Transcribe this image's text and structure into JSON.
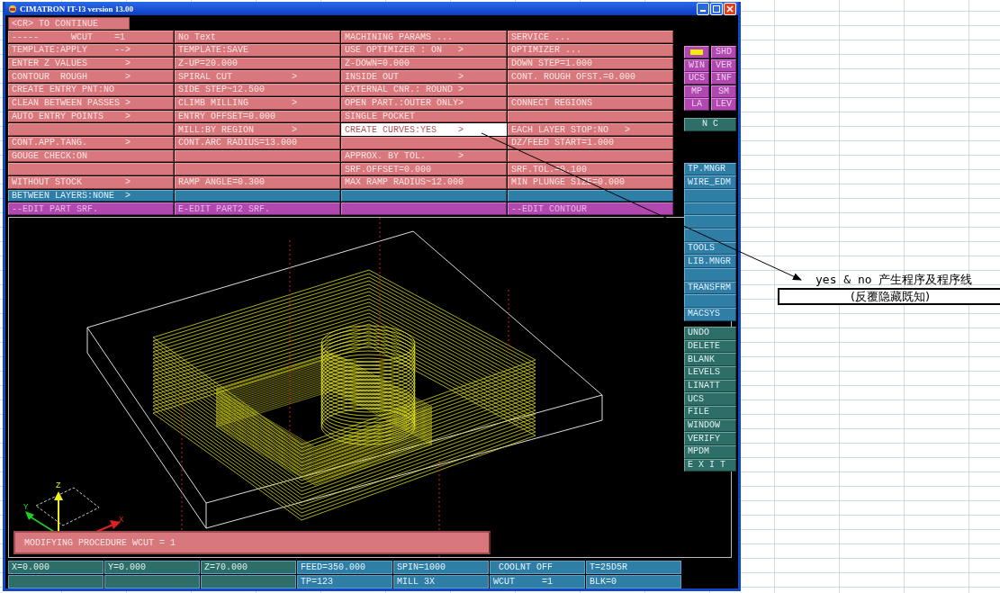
{
  "window": {
    "title": "CIMATRON IT-13 version 13.00"
  },
  "prompt": "<CR> TO CONTINUE",
  "menu": {
    "rows": [
      {
        "kind": "params",
        "cells": [
          {
            "label": "-----      WCUT    =1",
            "selected": false
          },
          {
            "label": "No Text",
            "selected": false
          },
          {
            "label": "MACHINING PARAMS ...",
            "selected": false
          },
          {
            "label": "SERVICE ...",
            "selected": false
          }
        ]
      },
      {
        "kind": "params",
        "cells": [
          {
            "label": "TEMPLATE:APPLY     -->",
            "selected": false
          },
          {
            "label": "TEMPLATE:SAVE",
            "selected": false
          },
          {
            "label": "USE OPTIMIZER : ON   >",
            "selected": false
          },
          {
            "label": "OPTIMIZER ...",
            "selected": false
          }
        ]
      },
      {
        "kind": "params",
        "cells": [
          {
            "label": "ENTER Z VALUES       >",
            "selected": false
          },
          {
            "label": "Z-UP=20.000",
            "selected": false
          },
          {
            "label": "Z-DOWN=0.000",
            "selected": false
          },
          {
            "label": "DOWN STEP=1.000",
            "selected": false
          }
        ]
      },
      {
        "kind": "params",
        "cells": [
          {
            "label": "CONTOUR  ROUGH       >",
            "selected": false
          },
          {
            "label": "SPIRAL CUT           >",
            "selected": false
          },
          {
            "label": "INSIDE OUT           >",
            "selected": false
          },
          {
            "label": "CONT. ROUGH OFST.=0.000",
            "selected": false
          }
        ]
      },
      {
        "kind": "params",
        "cells": [
          {
            "label": "CREATE ENTRY PNT:NO",
            "selected": false
          },
          {
            "label": "SIDE STEP~12.500",
            "selected": false
          },
          {
            "label": "EXTERNAL CNR.: ROUND >",
            "selected": false
          },
          {
            "selected": false
          }
        ]
      },
      {
        "kind": "params",
        "cells": [
          {
            "label": "CLEAN BETWEEN PASSES >",
            "selected": false
          },
          {
            "label": "CLIMB MILLING        >",
            "selected": false
          },
          {
            "label": "OPEN PART.:OUTER ONLY>",
            "selected": false
          },
          {
            "label": "CONNECT REGIONS",
            "selected": false
          }
        ]
      },
      {
        "kind": "params",
        "cells": [
          {
            "label": "AUTO ENTRY POINTS    >",
            "selected": false
          },
          {
            "label": "ENTRY OFFSET=0.000",
            "selected": false
          },
          {
            "label": "SINGLE POCKET",
            "selected": false
          },
          {
            "selected": false
          }
        ]
      },
      {
        "kind": "params",
        "cells": [
          {
            "selected": false
          },
          {
            "label": "MILL:BY REGION       >",
            "selected": false
          },
          {
            "label": "CREATE CURVES:YES    >",
            "selected": true
          },
          {
            "label": "EACH LAYER STOP:NO   >",
            "selected": false
          }
        ]
      },
      {
        "kind": "params",
        "cells": [
          {
            "label": "CONT.APP.TANG.       >",
            "selected": false
          },
          {
            "label": "CONT.ARC RADIUS=13.000",
            "selected": false
          },
          {
            "selected": false
          },
          {
            "label": "DZ/FEED START=1.000",
            "selected": false
          }
        ]
      },
      {
        "kind": "params",
        "cells": [
          {
            "label": "GOUGE CHECK:ON",
            "selected": false
          },
          {
            "selected": false
          },
          {
            "label": "APPROX. BY TOL.      >",
            "selected": false
          },
          {
            "selected": false
          }
        ]
      },
      {
        "kind": "params",
        "cells": [
          {
            "selected": false
          },
          {
            "selected": false
          },
          {
            "label": "SRF.OFFSET=0.000",
            "selected": false
          },
          {
            "label": "SRF.TOL.=0.100",
            "selected": false
          }
        ]
      },
      {
        "kind": "params",
        "cells": [
          {
            "label": "WITHOUT STOCK        >",
            "selected": false
          },
          {
            "label": "RAMP ANGLE=0.300",
            "selected": false
          },
          {
            "label": "MAX RAMP RADIUS~12.000",
            "selected": false
          },
          {
            "label": "MIN PLUNGE SIZE=0.000",
            "selected": false
          }
        ]
      },
      {
        "kind": "layers",
        "cells": [
          {
            "label": "BETWEEN LAYERS:NONE  >",
            "selected": false
          },
          {
            "selected": false
          },
          {
            "selected": false
          },
          {
            "selected": false
          }
        ]
      },
      {
        "kind": "edit",
        "cells": [
          {
            "label": "--EDIT PART SRF.",
            "selected": false
          },
          {
            "label": "E-EDIT PART2 SRF.",
            "selected": false
          },
          {
            "selected": false
          },
          {
            "label": "--EDIT CONTOUR",
            "selected": false
          }
        ]
      }
    ]
  },
  "side_panel": {
    "display_buttons": [
      {
        "kind": "swatch"
      },
      {
        "kind": "text",
        "label": "SHD"
      },
      {
        "kind": "text",
        "label": "WIN"
      },
      {
        "kind": "text",
        "label": "VER"
      },
      {
        "kind": "text",
        "label": "UCS"
      },
      {
        "kind": "text",
        "label": "INF"
      },
      {
        "kind": "text",
        "label": "MP"
      },
      {
        "kind": "text",
        "label": "SM"
      },
      {
        "kind": "text",
        "label": "LA"
      },
      {
        "kind": "text",
        "label": "LEV"
      }
    ],
    "mode": "N C",
    "module_buttons": [
      {
        "kind": "text",
        "label": "TP.MNGR"
      },
      {
        "kind": "text",
        "label": "WIRE_EDM"
      },
      {
        "kind": "blank"
      },
      {
        "kind": "blank"
      },
      {
        "kind": "blank"
      },
      {
        "kind": "blank"
      },
      {
        "kind": "text",
        "label": "TOOLS"
      },
      {
        "kind": "text",
        "label": "LIB.MNGR"
      },
      {
        "kind": "blank"
      },
      {
        "kind": "text",
        "label": "TRANSFRM"
      },
      {
        "kind": "blank"
      },
      {
        "kind": "text",
        "label": "MACSYS"
      }
    ],
    "command_buttons": [
      "UNDO",
      "DELETE",
      "BLANK",
      "LEVELS",
      "LINATT",
      "UCS",
      "FILE",
      "WINDOW",
      "VERIFY",
      "MPDM",
      "E X I T"
    ]
  },
  "axis_labels": {
    "x": "X",
    "y": "Y",
    "z": "Z"
  },
  "message": "MODIFYING PROCEDURE WCUT = 1",
  "status_bar": {
    "rows": [
      [
        {
          "kind": "coord",
          "text": "X=0.000"
        },
        {
          "kind": "coord",
          "text": "Y=0.000"
        },
        {
          "kind": "coord",
          "text": "Z=70.000"
        },
        {
          "kind": "info",
          "text": "FEED=350.000"
        },
        {
          "kind": "info",
          "text": "SPIN=1000"
        },
        {
          "kind": "info",
          "text": " COOLNT OFF"
        },
        {
          "kind": "info",
          "text": "T=25D5R"
        }
      ],
      [
        {
          "kind": "coord"
        },
        {
          "kind": "coord"
        },
        {
          "kind": "coord"
        },
        {
          "kind": "info",
          "text": "TP=123"
        },
        {
          "kind": "info",
          "text": "MILL 3X"
        },
        {
          "kind": "info",
          "text": "WCUT     =1"
        },
        {
          "kind": "info",
          "text": "BLK=0"
        }
      ]
    ]
  },
  "annotation": {
    "note": "yes & no 产生程序及程序线",
    "boxed_note": "(反覆隐藏既知)"
  }
}
